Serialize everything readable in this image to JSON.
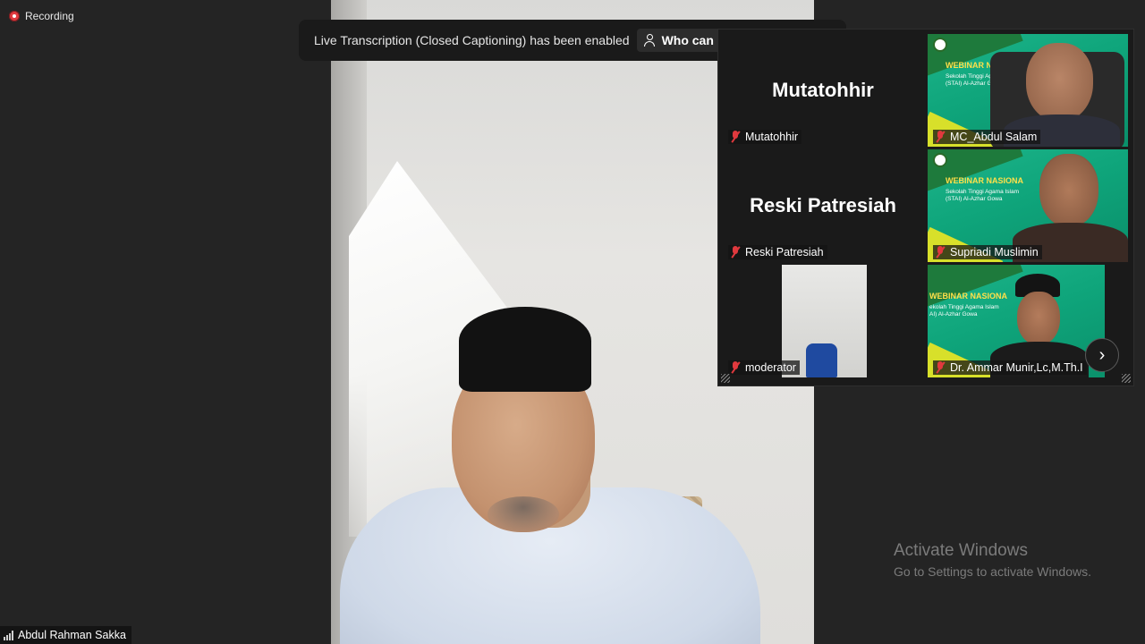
{
  "recording": {
    "label": "Recording"
  },
  "banner": {
    "message": "Live Transcription (Closed Captioning) has been enabled",
    "button_label": "Who can see t"
  },
  "gallery": {
    "tiles": [
      {
        "name": "Mutatohhir",
        "display": "Mutatohhir",
        "video": false,
        "muted": true
      },
      {
        "name": "MC_Abdul Salam",
        "video": true,
        "muted": true
      },
      {
        "name": "Reski Patresiah",
        "display": "Reski Patresiah",
        "video": false,
        "muted": true
      },
      {
        "name": "Supriadi Muslimin",
        "video": true,
        "muted": true
      },
      {
        "name": "moderator",
        "video": true,
        "muted": true
      },
      {
        "name": "Dr. Ammar Munir,Lc,M.Th.I",
        "video": true,
        "muted": true
      }
    ],
    "webinar_slide": {
      "title_a": "WEBINAR NAS",
      "title_b": "WEBINAR NASIONA",
      "title_c": "WEBINAR NASIONA",
      "line1_a": "Sekolah Tinggi Agama",
      "line2_a": "(STAI) Al-Azhar Gowa",
      "line1_b": "Sekolah Tinggi Agama Islam",
      "line2_b": "(STAI) Al-Azhar Gowa",
      "line1_c": "ekolah Tinggi Agama Islam",
      "line2_c": "AI) Al-Azhar Gowa"
    },
    "next_icon": "chevron-right-icon"
  },
  "main_speaker": {
    "name": "Abdul Rahman Sakka"
  },
  "watermark": {
    "title": "Activate Windows",
    "subtitle": "Go to Settings to activate Windows."
  },
  "colors": {
    "background": "#242424",
    "recording_red": "#e0393e",
    "muted_red": "#e0393e",
    "slide_green": "#0fa57b",
    "slide_yellow": "#ffe04a"
  }
}
